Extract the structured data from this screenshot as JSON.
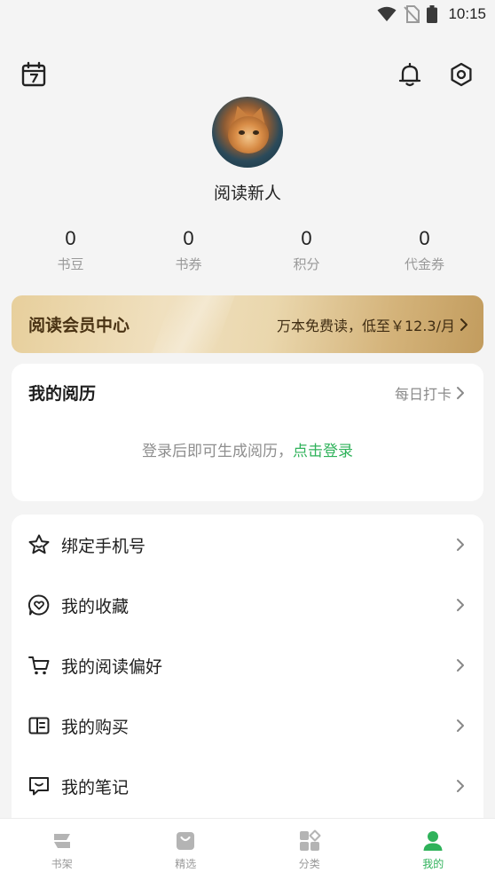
{
  "status_bar": {
    "time": "10:15",
    "icons": [
      "wifi-icon",
      "no-sim-icon",
      "battery-icon"
    ]
  },
  "header": {
    "left_icon": "calendar-icon",
    "right_icons": [
      "bell-icon",
      "settings-hex-icon"
    ]
  },
  "profile": {
    "username": "阅读新人",
    "avatar_icon": "cat-avatar"
  },
  "stats": [
    {
      "value": "0",
      "label": "书豆"
    },
    {
      "value": "0",
      "label": "书券"
    },
    {
      "value": "0",
      "label": "积分"
    },
    {
      "value": "0",
      "label": "代金券"
    }
  ],
  "vip": {
    "title": "阅读会员中心",
    "promo": "万本免费读，低至￥12.3/月"
  },
  "history": {
    "title": "我的阅历",
    "link": "每日打卡",
    "empty_text": "登录后即可生成阅历，",
    "login_link": "点击登录"
  },
  "menu": [
    {
      "label": "绑定手机号",
      "icon": "star-icon"
    },
    {
      "label": "我的收藏",
      "icon": "heart-bubble-icon"
    },
    {
      "label": "我的阅读偏好",
      "icon": "cart-icon"
    },
    {
      "label": "我的购买",
      "icon": "wallet-icon"
    },
    {
      "label": "我的笔记",
      "icon": "note-bubble-icon"
    }
  ],
  "tabs": [
    {
      "label": "书架",
      "icon": "bookshelf-icon"
    },
    {
      "label": "精选",
      "icon": "bag-icon"
    },
    {
      "label": "分类",
      "icon": "category-icon"
    },
    {
      "label": "我的",
      "icon": "person-icon",
      "active": true
    }
  ],
  "colors": {
    "accent_green": "#2fb25a",
    "vip_gold": "#d4b37a",
    "background": "#f4f4f4"
  }
}
